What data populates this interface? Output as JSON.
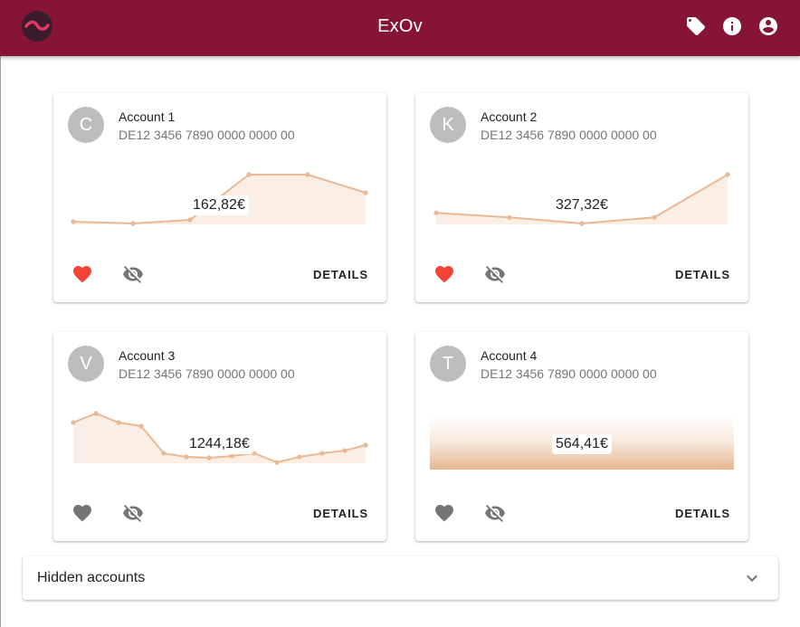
{
  "app": {
    "title": "ExOv"
  },
  "header_icons": [
    "tag-icon",
    "info-icon",
    "account-circle-icon"
  ],
  "colors": {
    "primary": "#851435",
    "chart_line": "#e8b994",
    "chart_fill": "#fbeee5",
    "favorite": "#f44336",
    "muted_icon": "#757575"
  },
  "accounts": [
    {
      "initial": "C",
      "name": "Account 1",
      "iban": "DE12 3456 7890 0000 0000 00",
      "balance": "162,82€",
      "favorite": true,
      "details_label": "DETAILS",
      "chart_kind": "line",
      "values": [
        162,
        161,
        163,
        188,
        188,
        178
      ]
    },
    {
      "initial": "K",
      "name": "Account 2",
      "iban": "DE12 3456 7890 0000 0000 00",
      "balance": "327,32€",
      "favorite": true,
      "details_label": "DETAILS",
      "chart_kind": "line",
      "values": [
        305,
        302,
        298,
        302,
        330
      ]
    },
    {
      "initial": "V",
      "name": "Account 3",
      "iban": "DE12 3456 7890 0000 0000 00",
      "balance": "1244,18€",
      "favorite": false,
      "details_label": "DETAILS",
      "chart_kind": "line",
      "values": [
        1287,
        1297,
        1287,
        1283,
        1253,
        1249,
        1248,
        1250,
        1253,
        1243,
        1249,
        1253,
        1256,
        1262
      ]
    },
    {
      "initial": "T",
      "name": "Account 4",
      "iban": "DE12 3456 7890 0000 0000 00",
      "balance": "564,41€",
      "favorite": false,
      "details_label": "DETAILS",
      "chart_kind": "gradient",
      "values": []
    }
  ],
  "hidden_panel": {
    "title": "Hidden accounts",
    "icon": "chevron-down-icon"
  }
}
